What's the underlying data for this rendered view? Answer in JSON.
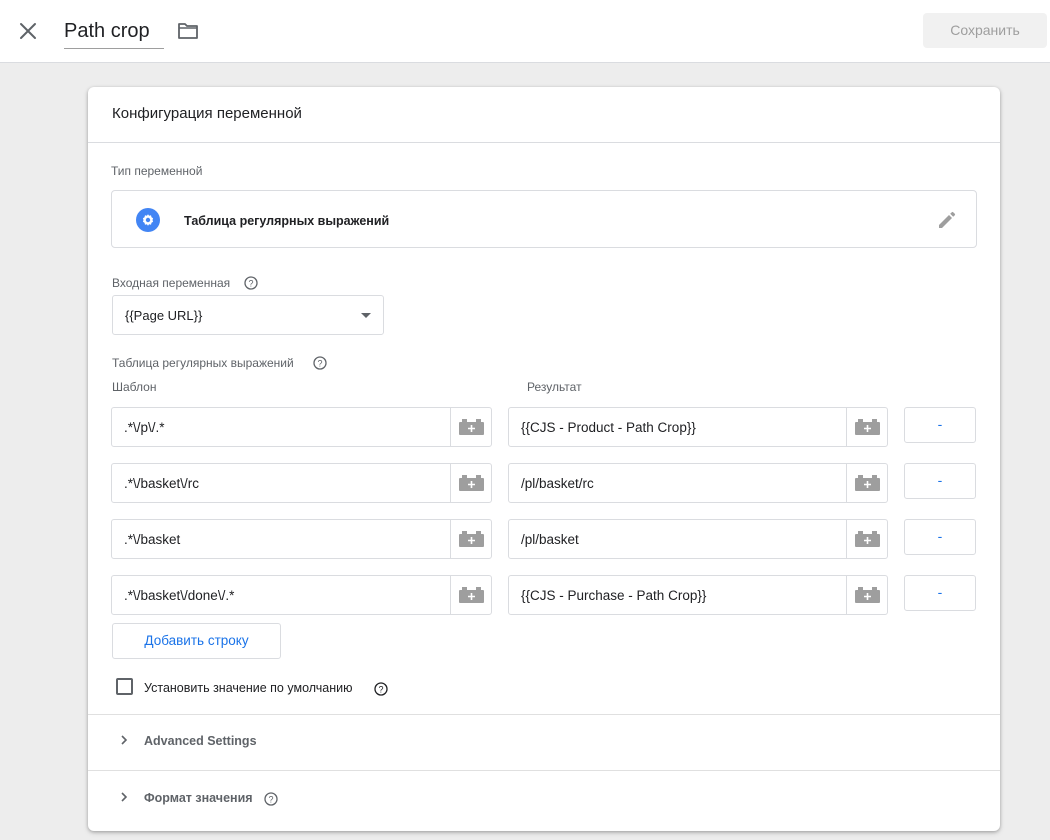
{
  "topbar": {
    "title": "Path crop",
    "save_label": "Сохранить"
  },
  "card": {
    "title": "Конфигурация переменной",
    "type_label": "Тип переменной",
    "type_name": "Таблица регулярных выражений",
    "input_label": "Входная переменная",
    "input_value": "{{Page URL}}",
    "table_label": "Таблица регулярных выражений",
    "col_pattern": "Шаблон",
    "col_result": "Результат",
    "rows": [
      {
        "pattern": ".*\\/p\\/.*",
        "result": "{{CJS - Product - Path Crop}}",
        "remove": "-"
      },
      {
        "pattern": ".*\\/basket\\/rc",
        "result": "/pl/basket/rc",
        "remove": "-"
      },
      {
        "pattern": ".*\\/basket",
        "result": "/pl/basket",
        "remove": "-"
      },
      {
        "pattern": ".*\\/basket\\/done\\/.*",
        "result": "{{CJS - Purchase - Path Crop}}",
        "remove": "-"
      }
    ],
    "add_row_label": "Добавить строку",
    "default_checkbox_label": "Установить значение по умолчанию",
    "advanced_label": "Advanced Settings",
    "format_label": "Формат значения"
  },
  "colors": {
    "accent": "#1a73e8",
    "icon_gray": "#5f6368"
  },
  "icons": [
    "close-icon",
    "folder-icon",
    "gear-icon",
    "edit-icon",
    "help-icon",
    "variable-brick-icon",
    "chevron-right-icon"
  ]
}
